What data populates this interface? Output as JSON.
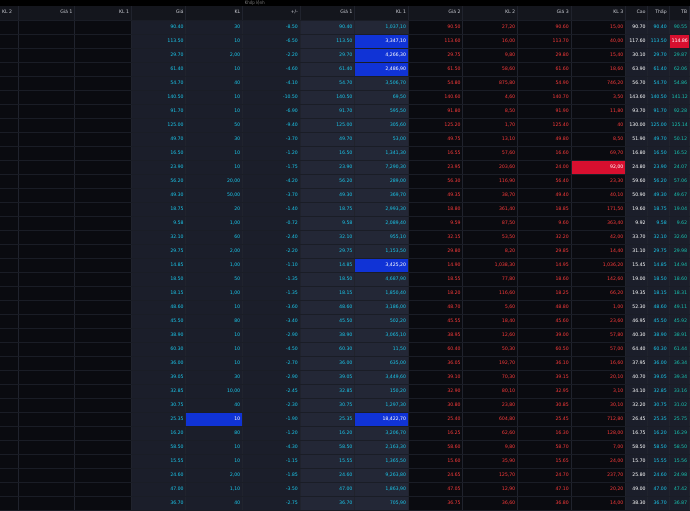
{
  "header": {
    "columns": [
      "KL 2",
      "Giá 1",
      "KL 1",
      "Giá",
      "KL",
      "+/-",
      "Giá 1",
      "KL 1",
      "Giá 2",
      "KL 2",
      "Giá 3",
      "KL 3",
      "Cao",
      "Thấp",
      "TB"
    ],
    "sub_label": "Khớp lệnh"
  },
  "colors": {
    "up": "#1ac8ec",
    "down": "#ff3b3b",
    "flat": "#17c4b2",
    "highlight_blue": "#1033d6",
    "highlight_red": "#d80f2f"
  },
  "rows": [
    {
      "gia": "90.40",
      "kl": "30",
      "pm": "-8.50",
      "g1": "90.40",
      "kl1": "1,037,10",
      "g2": "90.50",
      "kl2": "27,20",
      "g3": "90.60",
      "kl3": "15,00",
      "cao": "90.70",
      "thap": "90.40",
      "tb": "90.55"
    },
    {
      "gia": "113.50",
      "kl": "10",
      "pm": "-6.50",
      "g1": "113.50",
      "kl1": "3,347,10",
      "g2": "113.60",
      "kl2": "16,00",
      "g3": "113.70",
      "kl3": "40,00",
      "cao": "117.60",
      "thap": "113.50",
      "tb": "114.86"
    },
    {
      "gia": "29.70",
      "kl": "2,00",
      "pm": "-2.20",
      "g1": "29.70",
      "kl1": "4,266,30",
      "g2": "29.75",
      "kl2": "9,80",
      "g3": "29.80",
      "kl3": "15,40",
      "cao": "30.10",
      "thap": "29.70",
      "tb": "29.87"
    },
    {
      "gia": "61.40",
      "kl": "10",
      "pm": "-4.60",
      "g1": "61.40",
      "kl1": "2,486,90",
      "g2": "61.50",
      "kl2": "58,60",
      "g3": "61.60",
      "kl3": "18,60",
      "cao": "63.90",
      "thap": "61.40",
      "tb": "62.06"
    },
    {
      "gia": "54.70",
      "kl": "40",
      "pm": "-4.10",
      "g1": "54.70",
      "kl1": "3,506,70",
      "g2": "54.80",
      "kl2": "875,80",
      "g3": "54.90",
      "kl3": "746,20",
      "cao": "56.70",
      "thap": "54.70",
      "tb": "54.86"
    },
    {
      "gia": "140.50",
      "kl": "10",
      "pm": "-10.50",
      "g1": "140.50",
      "kl1": "69,50",
      "g2": "140.60",
      "kl2": "4,60",
      "g3": "140.70",
      "kl3": "3,50",
      "cao": "143.60",
      "thap": "140.50",
      "tb": "141.12"
    },
    {
      "gia": "91.70",
      "kl": "10",
      "pm": "-6.90",
      "g1": "91.70",
      "kl1": "595,50",
      "g2": "91.80",
      "kl2": "8,50",
      "g3": "91.90",
      "kl3": "11,80",
      "cao": "93.70",
      "thap": "91.70",
      "tb": "92.28"
    },
    {
      "gia": "125.00",
      "kl": "50",
      "pm": "-9.40",
      "g1": "125.00",
      "kl1": "305,60",
      "g2": "125.20",
      "kl2": "1,70",
      "g3": "125.40",
      "kl3": "40",
      "cao": "130.00",
      "thap": "125.00",
      "tb": "125.14"
    },
    {
      "gia": "49.70",
      "kl": "30",
      "pm": "-3.70",
      "g1": "49.70",
      "kl1": "53,00",
      "g2": "49.75",
      "kl2": "13,10",
      "g3": "49.80",
      "kl3": "8,50",
      "cao": "51.90",
      "thap": "49.70",
      "tb": "50.12"
    },
    {
      "gia": "16.50",
      "kl": "10",
      "pm": "-1.20",
      "g1": "16.50",
      "kl1": "1,341,30",
      "g2": "16.55",
      "kl2": "57,60",
      "g3": "16.60",
      "kl3": "69,70",
      "cao": "16.80",
      "thap": "16.50",
      "tb": "16.52"
    },
    {
      "gia": "23.90",
      "kl": "10",
      "pm": "-1.75",
      "g1": "23.90",
      "kl1": "7,290,30",
      "g2": "23.95",
      "kl2": "203,60",
      "g3": "24.00",
      "kl3": "92,00",
      "cao": "24.80",
      "thap": "23.90",
      "tb": "24.07"
    },
    {
      "gia": "56.20",
      "kl": "20,00",
      "pm": "-4.20",
      "g1": "56.20",
      "kl1": "289,00",
      "g2": "56.30",
      "kl2": "116,90",
      "g3": "56.40",
      "kl3": "23,30",
      "cao": "59.60",
      "thap": "56.20",
      "tb": "57.06"
    },
    {
      "gia": "49.30",
      "kl": "50,00",
      "pm": "-3.70",
      "g1": "49.30",
      "kl1": "369,70",
      "g2": "49.35",
      "kl2": "38,70",
      "g3": "49.40",
      "kl3": "40,10",
      "cao": "50.90",
      "thap": "49.30",
      "tb": "49.67"
    },
    {
      "gia": "18.75",
      "kl": "20",
      "pm": "-1.40",
      "g1": "18.75",
      "kl1": "2,993,30",
      "g2": "18.80",
      "kl2": "361,40",
      "g3": "18.85",
      "kl3": "171,50",
      "cao": "19.60",
      "thap": "18.75",
      "tb": "19.04"
    },
    {
      "gia": "9.58",
      "kl": "1,00",
      "pm": "-0.72",
      "g1": "9.58",
      "kl1": "2,089,40",
      "g2": "9.59",
      "kl2": "87,50",
      "g3": "9.60",
      "kl3": "363,40",
      "cao": "9.92",
      "thap": "9.58",
      "tb": "9.62"
    },
    {
      "gia": "32.10",
      "kl": "60",
      "pm": "-2.40",
      "g1": "32.10",
      "kl1": "955,10",
      "g2": "32.15",
      "kl2": "53,50",
      "g3": "32.20",
      "kl3": "42,00",
      "cao": "33.70",
      "thap": "32.10",
      "tb": "32.60"
    },
    {
      "gia": "29.75",
      "kl": "2,00",
      "pm": "-2.20",
      "g1": "29.75",
      "kl1": "1,153,50",
      "g2": "29.80",
      "kl2": "8,20",
      "g3": "29.85",
      "kl3": "14,40",
      "cao": "31.10",
      "thap": "29.75",
      "tb": "29.98"
    },
    {
      "gia": "14.85",
      "kl": "1,00",
      "pm": "-1.10",
      "g1": "14.85",
      "kl1": "3,425,20",
      "g2": "14.90",
      "kl2": "1,038,30",
      "g3": "14.95",
      "kl3": "1,036,20",
      "cao": "15.45",
      "thap": "14.85",
      "tb": "14.94"
    },
    {
      "gia": "18.50",
      "kl": "50",
      "pm": "-1.35",
      "g1": "18.50",
      "kl1": "4,687,90",
      "g2": "18.55",
      "kl2": "77,80",
      "g3": "18.60",
      "kl3": "142,60",
      "cao": "19.00",
      "thap": "18.50",
      "tb": "18.60"
    },
    {
      "gia": "18.15",
      "kl": "1,00",
      "pm": "-1.35",
      "g1": "18.15",
      "kl1": "1,850,40",
      "g2": "18.20",
      "kl2": "116,60",
      "g3": "18.25",
      "kl3": "66,20",
      "cao": "19.35",
      "thap": "18.15",
      "tb": "18.31"
    },
    {
      "gia": "48.60",
      "kl": "10",
      "pm": "-3.60",
      "g1": "48.60",
      "kl1": "3,186,00",
      "g2": "48.70",
      "kl2": "5,60",
      "g3": "48.80",
      "kl3": "1,00",
      "cao": "52.30",
      "thap": "48.60",
      "tb": "49.11"
    },
    {
      "gia": "45.50",
      "kl": "80",
      "pm": "-3.40",
      "g1": "45.50",
      "kl1": "502,20",
      "g2": "45.55",
      "kl2": "18,40",
      "g3": "45.60",
      "kl3": "23,60",
      "cao": "46.95",
      "thap": "45.50",
      "tb": "45.92"
    },
    {
      "gia": "38.90",
      "kl": "10",
      "pm": "-2.90",
      "g1": "38.90",
      "kl1": "3,065,10",
      "g2": "38.95",
      "kl2": "12,60",
      "g3": "39.00",
      "kl3": "57,80",
      "cao": "40.30",
      "thap": "38.90",
      "tb": "38.91"
    },
    {
      "gia": "60.30",
      "kl": "10",
      "pm": "-4.50",
      "g1": "60.30",
      "kl1": "11,50",
      "g2": "60.40",
      "kl2": "50,30",
      "g3": "60.50",
      "kl3": "57,00",
      "cao": "64.40",
      "thap": "60.30",
      "tb": "61.44"
    },
    {
      "gia": "36.00",
      "kl": "10",
      "pm": "-2.70",
      "g1": "36.00",
      "kl1": "635,00",
      "g2": "36.05",
      "kl2": "192,70",
      "g3": "36.10",
      "kl3": "16,60",
      "cao": "37.95",
      "thap": "36.00",
      "tb": "36.34"
    },
    {
      "gia": "39.05",
      "kl": "30",
      "pm": "-2.90",
      "g1": "39.05",
      "kl1": "3,449,60",
      "g2": "39.10",
      "kl2": "70,30",
      "g3": "39.15",
      "kl3": "20,10",
      "cao": "40.70",
      "thap": "39.05",
      "tb": "39.34"
    },
    {
      "gia": "32.85",
      "kl": "10,00",
      "pm": "-2.45",
      "g1": "32.85",
      "kl1": "150,20",
      "g2": "32.90",
      "kl2": "80,10",
      "g3": "32.95",
      "kl3": "3,10",
      "cao": "34.10",
      "thap": "32.85",
      "tb": "33.16"
    },
    {
      "gia": "30.75",
      "kl": "40",
      "pm": "-2.30",
      "g1": "30.75",
      "kl1": "1,297,30",
      "g2": "30.80",
      "kl2": "23,80",
      "g3": "30.85",
      "kl3": "30,10",
      "cao": "32.20",
      "thap": "30.75",
      "tb": "31.02"
    },
    {
      "gia": "25.35",
      "kl": "10",
      "pm": "-1.90",
      "g1": "25.35",
      "kl1": "18,422,70",
      "g2": "25.40",
      "kl2": "604,80",
      "g3": "25.45",
      "kl3": "712,80",
      "cao": "26.45",
      "thap": "25.35",
      "tb": "25.75"
    },
    {
      "gia": "16.20",
      "kl": "80",
      "pm": "-1.20",
      "g1": "16.20",
      "kl1": "3,206,70",
      "g2": "16.25",
      "kl2": "62,60",
      "g3": "16.30",
      "kl3": "128,00",
      "cao": "16.75",
      "thap": "16.20",
      "tb": "16.29"
    },
    {
      "gia": "58.50",
      "kl": "10",
      "pm": "-4.30",
      "g1": "58.50",
      "kl1": "2,163,30",
      "g2": "58.60",
      "kl2": "9,80",
      "g3": "58.70",
      "kl3": "7,00",
      "cao": "58.50",
      "thap": "58.50",
      "tb": "58.50"
    },
    {
      "gia": "15.55",
      "kl": "10",
      "pm": "-1.15",
      "g1": "15.55",
      "kl1": "1,365,50",
      "g2": "15.60",
      "kl2": "35,90",
      "g3": "15.65",
      "kl3": "24,00",
      "cao": "15.70",
      "thap": "15.55",
      "tb": "15.56"
    },
    {
      "gia": "24.60",
      "kl": "2,00",
      "pm": "-1.85",
      "g1": "24.60",
      "kl1": "9,263,80",
      "g2": "24.65",
      "kl2": "125,70",
      "g3": "24.70",
      "kl3": "237,70",
      "cao": "25.80",
      "thap": "24.60",
      "tb": "24.98"
    },
    {
      "gia": "47.00",
      "kl": "1,10",
      "pm": "-3.50",
      "g1": "47.00",
      "kl1": "1,863,90",
      "g2": "47.05",
      "kl2": "12,90",
      "g3": "47.10",
      "kl3": "20,20",
      "cao": "49.00",
      "thap": "47.00",
      "tb": "47.42"
    },
    {
      "gia": "36.70",
      "kl": "40",
      "pm": "-2.75",
      "g1": "36.70",
      "kl1": "705,90",
      "g2": "36.75",
      "kl2": "36,60",
      "g3": "36.80",
      "kl3": "14,00",
      "cao": "38.30",
      "thap": "36.70",
      "tb": "36.87"
    }
  ]
}
